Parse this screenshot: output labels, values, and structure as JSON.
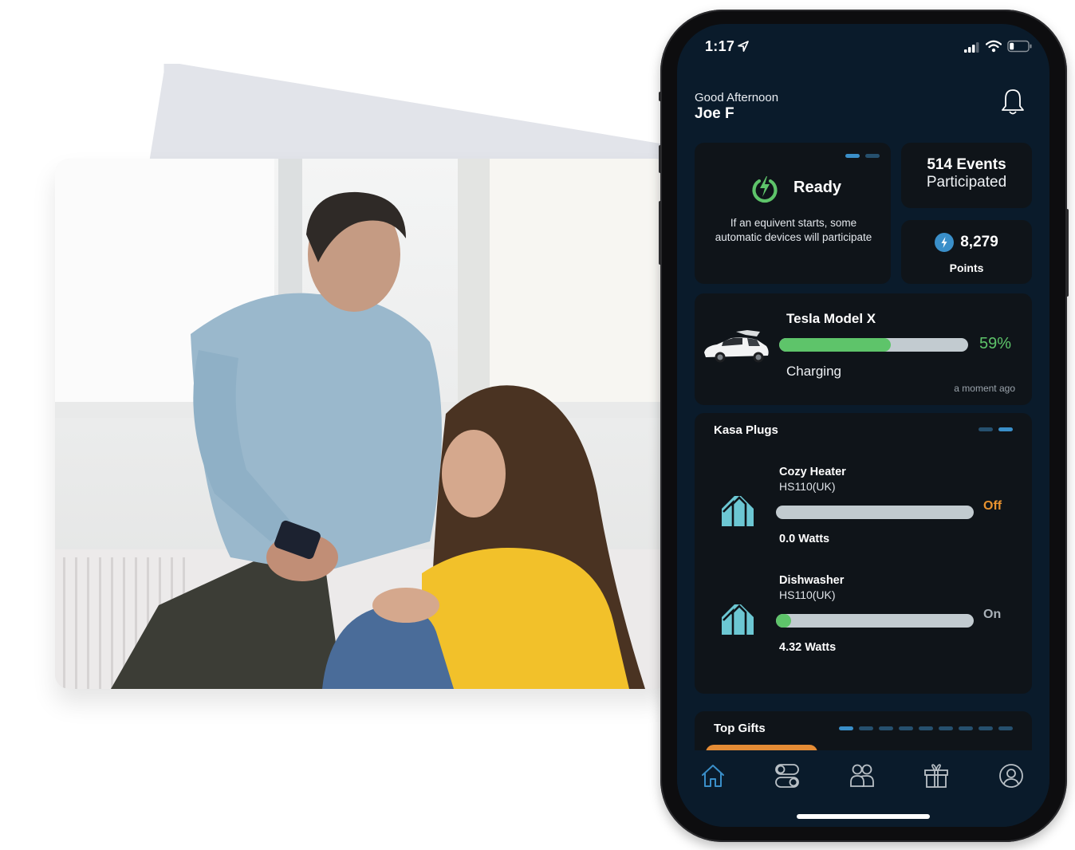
{
  "status_bar": {
    "time": "1:17"
  },
  "header": {
    "greeting": "Good Afternoon",
    "user_name": "Joe F"
  },
  "ready_card": {
    "title": "Ready",
    "description": "If an equivent starts, some automatic devices will participate",
    "pager_total": 2,
    "pager_active": 1
  },
  "events_card": {
    "count": "514 Events",
    "label": "Participated"
  },
  "points_card": {
    "value": "8,279",
    "label": "Points"
  },
  "tesla_card": {
    "name": "Tesla Model X",
    "charge_percent": 59,
    "charge_label": "59%",
    "status": "Charging",
    "updated": "a moment ago"
  },
  "kasa_card": {
    "title": "Kasa Plugs",
    "pager_total": 2,
    "pager_active": 2,
    "plugs": [
      {
        "name": "Cozy Heater",
        "model": "HS110(UK)",
        "state": "Off",
        "watts": "0.0 Watts",
        "usage_fraction": 0
      },
      {
        "name": "Dishwasher",
        "model": "HS110(UK)",
        "state": "On",
        "watts": "4.32 Watts",
        "usage_fraction": 0.02
      }
    ]
  },
  "gifts_card": {
    "title": "Top Gifts",
    "pager_total": 9,
    "pager_active": 1
  },
  "tab_bar": {
    "items": [
      {
        "name": "home",
        "icon": "home-icon",
        "active": true
      },
      {
        "name": "devices",
        "icon": "toggles-icon",
        "active": false
      },
      {
        "name": "community",
        "icon": "people-icon",
        "active": false
      },
      {
        "name": "gifts",
        "icon": "gift-icon",
        "active": false
      },
      {
        "name": "profile",
        "icon": "profile-icon",
        "active": false
      }
    ]
  },
  "colors": {
    "screen_bg": "#0a1b2b",
    "card_bg": "#0f1419",
    "accent_blue": "#3a8fc9",
    "success_green": "#5ec46a",
    "off_orange": "#e8922f",
    "kasa_teal": "#6cc7d3"
  }
}
